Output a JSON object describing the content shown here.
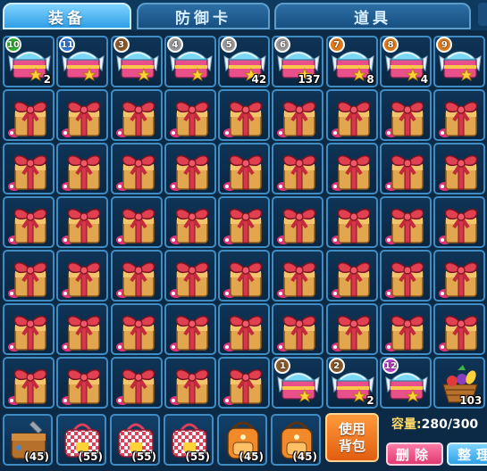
{
  "tabs": [
    {
      "label": "装备",
      "active": true
    },
    {
      "label": "防御卡",
      "active": false
    },
    {
      "label": "道具",
      "active": false
    }
  ],
  "inventory": {
    "top_row": [
      {
        "item": "star-card-chest-icon",
        "level": "10",
        "badge_color": "#2fb52f",
        "qty": "2"
      },
      {
        "item": "star-card-chest-icon",
        "level": "11",
        "badge_color": "#2f7de0",
        "qty": ""
      },
      {
        "item": "star-card-chest-icon",
        "level": "3",
        "badge_color": "#8a5a2a",
        "qty": ""
      },
      {
        "item": "star-card-chest-icon",
        "level": "4",
        "badge_color": "#9a9a9a",
        "qty": ""
      },
      {
        "item": "star-card-chest-icon",
        "level": "5",
        "badge_color": "#9a9a9a",
        "qty": "42"
      },
      {
        "item": "star-card-chest-icon",
        "level": "6",
        "badge_color": "#9a9a9a",
        "qty": "137"
      },
      {
        "item": "star-card-chest-icon",
        "level": "7",
        "badge_color": "#e07a1a",
        "qty": "8"
      },
      {
        "item": "star-card-chest-icon",
        "level": "8",
        "badge_color": "#e07a1a",
        "qty": "4"
      },
      {
        "item": "star-card-chest-icon",
        "level": "9",
        "badge_color": "#e07a1a",
        "qty": ""
      }
    ],
    "gift_rows": 5,
    "last_row": [
      {
        "item": "gift-box-icon",
        "level": "",
        "badge_color": "",
        "qty": ""
      },
      {
        "item": "gift-box-icon",
        "level": "",
        "badge_color": "",
        "qty": ""
      },
      {
        "item": "gift-box-icon",
        "level": "",
        "badge_color": "",
        "qty": ""
      },
      {
        "item": "gift-box-icon",
        "level": "",
        "badge_color": "",
        "qty": ""
      },
      {
        "item": "gift-box-icon",
        "level": "",
        "badge_color": "",
        "qty": ""
      },
      {
        "item": "star-card-chest-icon",
        "level": "1",
        "badge_color": "#8a5a2a",
        "qty": ""
      },
      {
        "item": "star-card-chest-icon",
        "level": "2",
        "badge_color": "#8a5a2a",
        "qty": "2"
      },
      {
        "item": "star-card-chest-icon",
        "level": "12",
        "badge_color": "#c040d0",
        "qty": ""
      },
      {
        "item": "fruit-basket-icon",
        "level": "",
        "badge_color": "",
        "qty": "103"
      }
    ]
  },
  "equipped": [
    {
      "item": "backpack-icon",
      "level": "(45)"
    },
    {
      "item": "checkered-bag-icon",
      "level": "(55)"
    },
    {
      "item": "checkered-bag-icon",
      "level": "(55)"
    },
    {
      "item": "checkered-bag-icon",
      "level": "(55)"
    },
    {
      "item": "orange-backpack-icon",
      "level": "(45)"
    },
    {
      "item": "orange-backpack-icon",
      "level": "(45)"
    }
  ],
  "actions": {
    "use_line1": "使用",
    "use_line2": "背包",
    "delete_label": "删除",
    "sort_label": "整理"
  },
  "capacity": {
    "label": "容量:",
    "value": "280/300"
  },
  "colors": {
    "accent_blue": "#2f9fe6",
    "use_orange": "#e25d10",
    "delete_pink": "#e03a73"
  }
}
